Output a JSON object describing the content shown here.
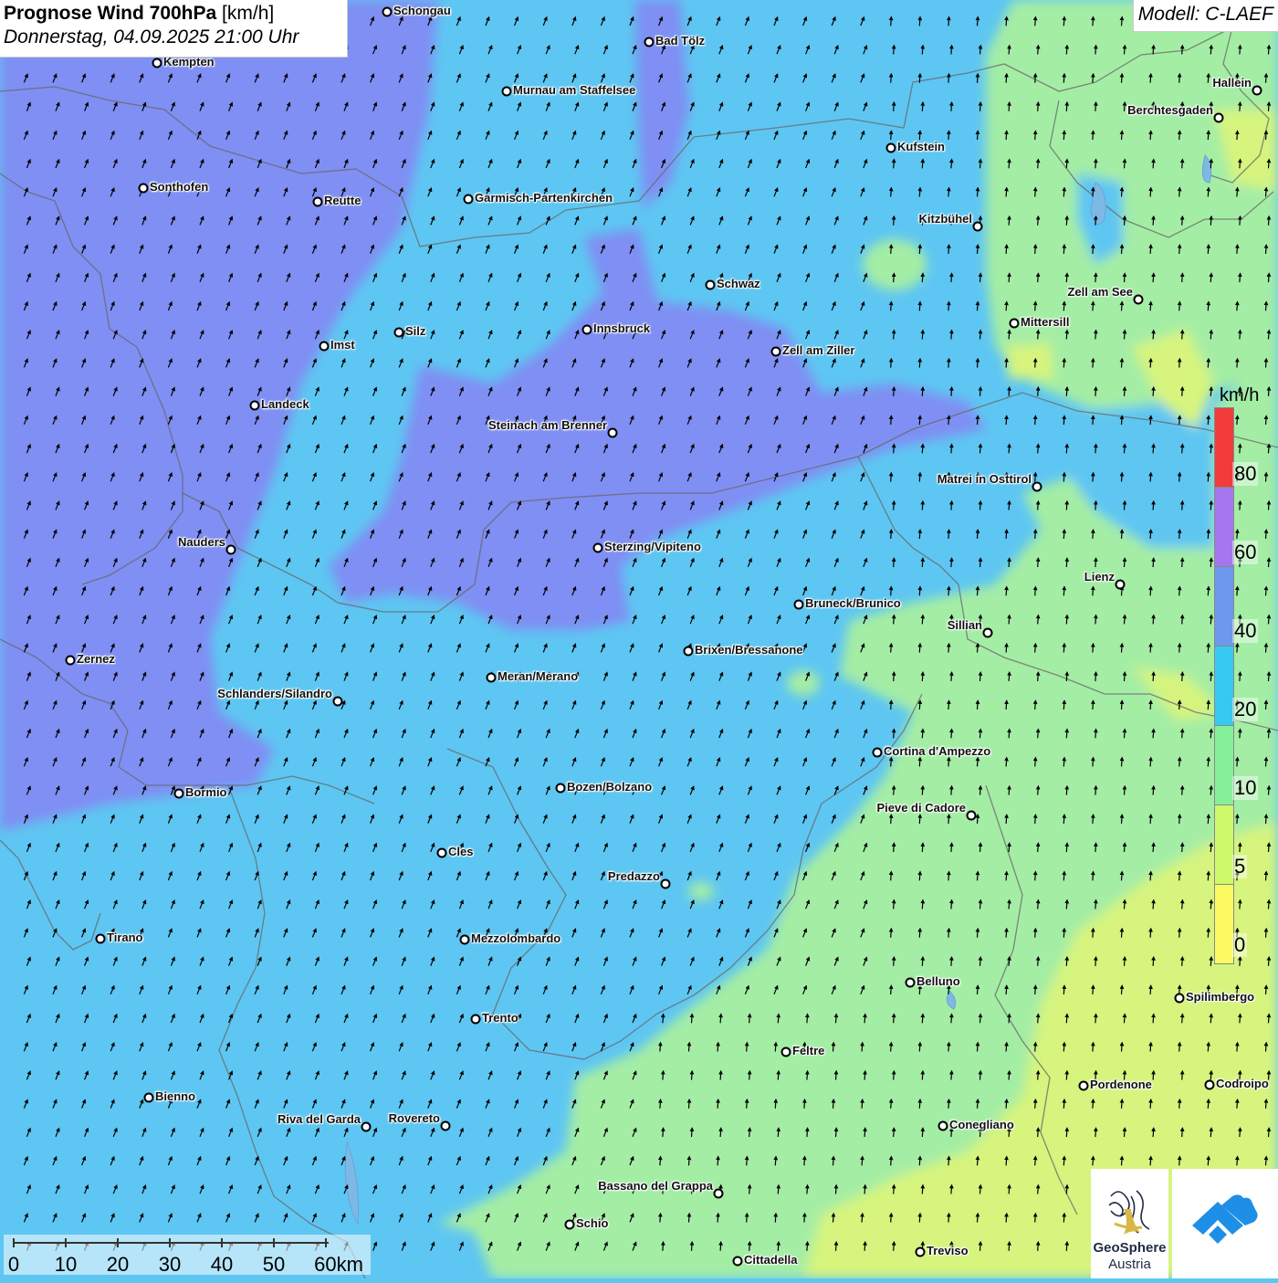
{
  "header": {
    "title_bold": "Prognose Wind 700hPa",
    "title_unit": "[km/h]",
    "datetime": "Donnerstag, 04.09.2025 21:00 Uhr"
  },
  "model_label": "Modell: C-LAEF",
  "legend": {
    "unit": "km/h",
    "segments": [
      {
        "color": "#f23b3b"
      },
      {
        "color": "#a576ee"
      },
      {
        "color": "#6d98ec"
      },
      {
        "color": "#38c9f3"
      },
      {
        "color": "#84f09a"
      },
      {
        "color": "#cdf96a"
      },
      {
        "color": "#fbfa63"
      }
    ],
    "labels": [
      "80",
      "60",
      "40",
      "20",
      "10",
      "5",
      "0"
    ]
  },
  "scale_bar": {
    "labels": [
      "0",
      "10",
      "20",
      "30",
      "40",
      "50",
      "60km"
    ]
  },
  "logos": {
    "geosphere_text_1": "GeoSphere",
    "geosphere_text_2": "Austria"
  },
  "colors": {
    "strong_purple": "#7f8ff3",
    "blue": "#6d98ec",
    "cyan": "#5ec6f2",
    "green": "#a4eda5",
    "yellow_green": "#d6f47e"
  },
  "cities": [
    {
      "name": "Schongau",
      "side": "r"
    },
    {
      "name": "Bad Tölz",
      "side": "r"
    },
    {
      "name": "Kempten",
      "side": "r"
    },
    {
      "name": "Murnau am Staffelsee",
      "side": "r"
    },
    {
      "name": "Hallein",
      "side": "l"
    },
    {
      "name": "Berchtesgaden",
      "side": "l"
    },
    {
      "name": "Kufstein",
      "side": "r"
    },
    {
      "name": "Sonthofen",
      "side": "r"
    },
    {
      "name": "Reutte",
      "side": "r"
    },
    {
      "name": "Garmisch-Partenkirchen",
      "side": "r"
    },
    {
      "name": "Kitzbühel",
      "side": "l"
    },
    {
      "name": "Schwaz",
      "side": "r"
    },
    {
      "name": "Zell am See",
      "side": "l"
    },
    {
      "name": "Mittersill",
      "side": "r"
    },
    {
      "name": "Silz",
      "side": "r"
    },
    {
      "name": "Innsbruck",
      "side": "r"
    },
    {
      "name": "Imst",
      "side": "r"
    },
    {
      "name": "Zell am Ziller",
      "side": "r"
    },
    {
      "name": "Landeck",
      "side": "r"
    },
    {
      "name": "Steinach am Brenner",
      "side": "l"
    },
    {
      "name": "Matrei in Osttirol",
      "side": "l"
    },
    {
      "name": "Nauders",
      "side": "l"
    },
    {
      "name": "Sterzing/Vipiteno",
      "side": "r"
    },
    {
      "name": "Lienz",
      "side": "l"
    },
    {
      "name": "Bruneck/Brunico",
      "side": "r"
    },
    {
      "name": "Sillian",
      "side": "l"
    },
    {
      "name": "Zernez",
      "side": "r"
    },
    {
      "name": "Brixen/Bressanone",
      "side": "r"
    },
    {
      "name": "Meran/Merano",
      "side": "r"
    },
    {
      "name": "Schlanders/Silandro",
      "side": "l"
    },
    {
      "name": "Cortina d'Ampezzo",
      "side": "r"
    },
    {
      "name": "Bozen/Bolzano",
      "side": "r"
    },
    {
      "name": "Bormio",
      "side": "r"
    },
    {
      "name": "Pieve di Cadore",
      "side": "l"
    },
    {
      "name": "Cles",
      "side": "r"
    },
    {
      "name": "Predazzo",
      "side": "l"
    },
    {
      "name": "Tirano",
      "side": "r"
    },
    {
      "name": "Mezzolombardo",
      "side": "r"
    },
    {
      "name": "Belluno",
      "side": "r"
    },
    {
      "name": "Spilimbergo",
      "side": "r"
    },
    {
      "name": "Trento",
      "side": "r"
    },
    {
      "name": "Feltre",
      "side": "r"
    },
    {
      "name": "Pordenone",
      "side": "r"
    },
    {
      "name": "Codroipo",
      "side": "r"
    },
    {
      "name": "Bienno",
      "side": "r"
    },
    {
      "name": "Riva del Garda",
      "side": "l"
    },
    {
      "name": "Rovereto",
      "side": "l"
    },
    {
      "name": "Conegliano",
      "side": "r"
    },
    {
      "name": "Bassano del Grappa",
      "side": "l"
    },
    {
      "name": "Schio",
      "side": "r"
    },
    {
      "name": "Treviso",
      "side": "r"
    },
    {
      "name": "Cittadella",
      "side": "r"
    }
  ]
}
